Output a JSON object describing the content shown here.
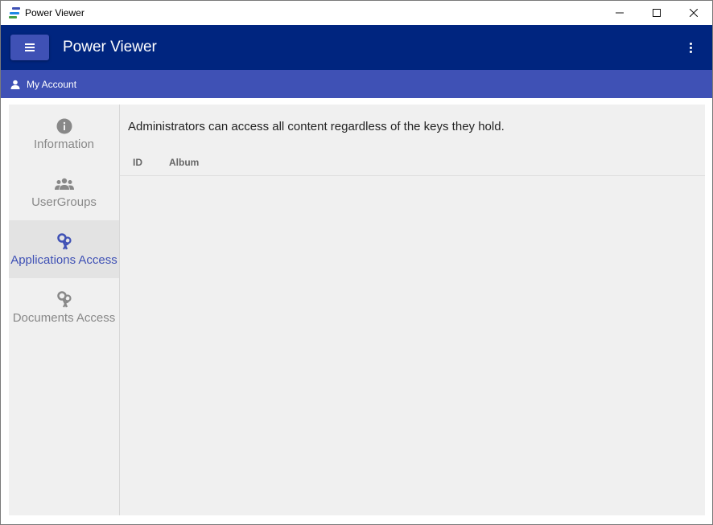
{
  "window": {
    "title": "Power Viewer"
  },
  "appbar": {
    "title": "Power Viewer"
  },
  "subbar": {
    "label": "My Account"
  },
  "sidebar": {
    "items": [
      {
        "label": "Information",
        "icon": "info-icon",
        "active": false
      },
      {
        "label": "UserGroups",
        "icon": "users-group-icon",
        "active": false
      },
      {
        "label": "Applications Access",
        "icon": "key-access-icon",
        "active": true
      },
      {
        "label": "Documents Access",
        "icon": "key-access-icon",
        "active": false
      }
    ]
  },
  "main": {
    "message": "Administrators can access all content regardless of the keys they hold.",
    "table": {
      "columns": [
        "ID",
        "Album"
      ],
      "rows": []
    }
  },
  "colors": {
    "titlebar_bg": "#ffffff",
    "appbar_bg": "#00257f",
    "subbar_bg": "#3f51b5",
    "accent": "#3f51b5",
    "content_bg": "#f0f0f0",
    "inactive_text": "#888888"
  }
}
